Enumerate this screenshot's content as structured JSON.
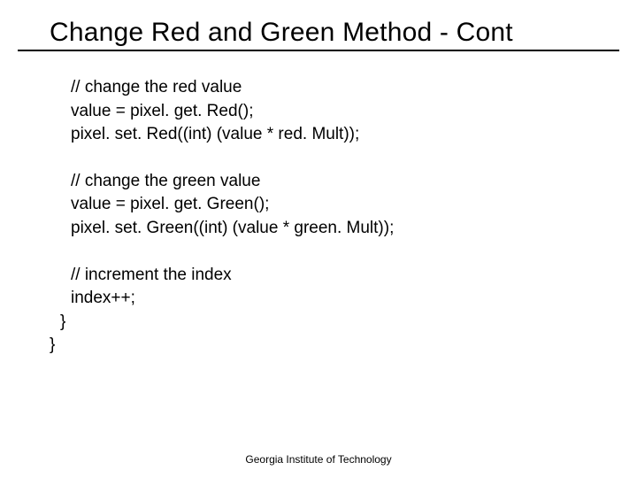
{
  "title": "Change Red and Green Method - Cont",
  "code": {
    "block1": {
      "l1": "// change the red value",
      "l2": "value = pixel. get. Red();",
      "l3": "pixel. set. Red((int) (value * red. Mult));"
    },
    "block2": {
      "l1": "// change the green value",
      "l2": "value = pixel. get. Green();",
      "l3": "pixel. set. Green((int) (value * green. Mult));"
    },
    "block3": {
      "l1": "// increment the index",
      "l2": "index++;"
    },
    "brace1": "}",
    "brace2": "}"
  },
  "footer": "Georgia Institute of Technology"
}
